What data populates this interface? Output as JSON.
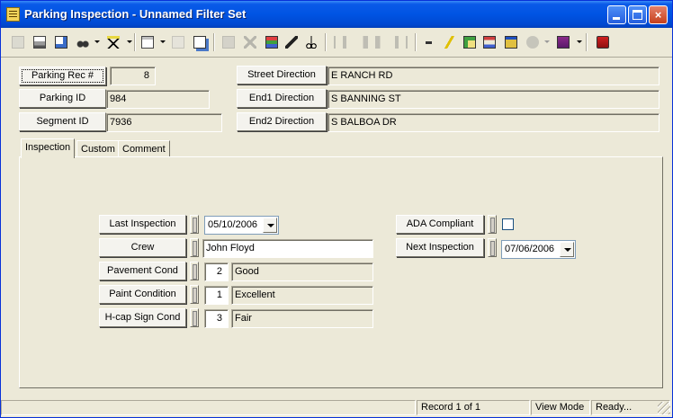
{
  "window": {
    "title": "Parking Inspection - Unnamed Filter Set",
    "controls": {
      "minimize": "minimize",
      "maximize": "maximize",
      "close": "×"
    }
  },
  "toolbar": {
    "icons": [
      "new-record-icon",
      "print-icon",
      "print-preview-icon",
      "binoculars-search-icon",
      "filter-icon",
      "report-icon",
      "copy-icon",
      "paste-icon",
      "save-icon",
      "delete-icon",
      "attach-icon",
      "edit-pencil-icon",
      "cut-scissors-icon",
      "first-record-icon",
      "previous-record-icon",
      "next-record-icon",
      "last-record-icon",
      "go-arrow-icon",
      "lightning-icon",
      "map-icon",
      "tree-icon",
      "window-icon",
      "globe-icon",
      "book-icon",
      "exit-icon"
    ]
  },
  "header": {
    "parking_rec_label": "Parking Rec #",
    "parking_rec_value": "8",
    "parking_id_label": "Parking ID",
    "parking_id_value": "984",
    "segment_id_label": "Segment ID",
    "segment_id_value": "7936",
    "street_direction_label": "Street Direction",
    "street_direction_value": "E RANCH RD",
    "end1_direction_label": "End1 Direction",
    "end1_direction_value": "S BANNING ST",
    "end2_direction_label": "End2 Direction",
    "end2_direction_value": "S BALBOA DR"
  },
  "tabs": [
    {
      "label": "Inspection",
      "active": true
    },
    {
      "label": "Custom",
      "active": false
    },
    {
      "label": "Comment",
      "active": false
    }
  ],
  "inspection": {
    "last_inspection_label": "Last Inspection",
    "last_inspection_value": "05/10/2006",
    "crew_label": "Crew",
    "crew_value": "John Floyd",
    "pavement_cond_label": "Pavement Cond",
    "pavement_cond_code": "2",
    "pavement_cond_desc": "Good",
    "paint_condition_label": "Paint Condition",
    "paint_condition_code": "1",
    "paint_condition_desc": "Excellent",
    "hcap_sign_cond_label": "H-cap Sign Cond",
    "hcap_sign_cond_code": "3",
    "hcap_sign_cond_desc": "Fair",
    "ada_compliant_label": "ADA Compliant",
    "ada_compliant_checked": false,
    "next_inspection_label": "Next Inspection",
    "next_inspection_value": "07/06/2006"
  },
  "status": {
    "record": "Record 1 of 1",
    "mode": "View Mode",
    "state": "Ready..."
  }
}
